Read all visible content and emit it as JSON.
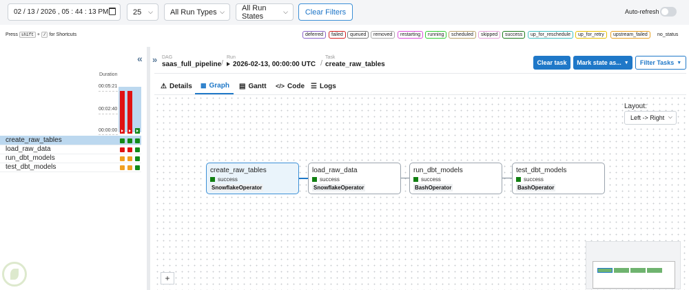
{
  "filters": {
    "datetime": "02 / 13 / 2026 ,  05 : 44 : 13  PM",
    "page_size": "25",
    "run_types": "All Run Types",
    "run_states": "All Run States",
    "clear_filters": "Clear Filters",
    "auto_refresh": "Auto-refresh",
    "auto_refresh_on": false
  },
  "shortcuts": {
    "press": "Press",
    "key1": "shift",
    "plus": "+",
    "key2": "/",
    "suffix": "for Shortcuts"
  },
  "states": [
    {
      "label": "deferred",
      "color": "#8a64c8"
    },
    {
      "label": "failed",
      "color": "#d21f1f"
    },
    {
      "label": "queued",
      "color": "#777777"
    },
    {
      "label": "removed",
      "color": "#aaaaaa"
    },
    {
      "label": "restarting",
      "color": "#d94fd9"
    },
    {
      "label": "running",
      "color": "#32cd32"
    },
    {
      "label": "scheduled",
      "color": "#b8a16a"
    },
    {
      "label": "skipped",
      "color": "#e4a0d8"
    },
    {
      "label": "success",
      "color": "#1b7a1b"
    },
    {
      "label": "up_for_reschedule",
      "color": "#40c0c0"
    },
    {
      "label": "up_for_retry",
      "color": "#e8c000"
    },
    {
      "label": "upstream_failed",
      "color": "#e8a020"
    },
    {
      "label": "no_status",
      "color": "#ffffff"
    }
  ],
  "grid": {
    "duration_label": "Duration",
    "ticks": [
      "00:05:21",
      "00:02:40",
      "00:00:00"
    ],
    "runs": [
      {
        "fraction": 0.97,
        "color": "#e01212"
      },
      {
        "fraction": 0.97,
        "color": "#e01212"
      },
      {
        "fraction": 0.12,
        "color": "#16881b"
      }
    ],
    "tasks": [
      {
        "name": "create_raw_tables",
        "states": [
          "#138a18",
          "#138a18",
          "#138a18"
        ]
      },
      {
        "name": "load_raw_data",
        "states": [
          "#e01212",
          "#e01212",
          "#138a18"
        ]
      },
      {
        "name": "run_dbt_models",
        "states": [
          "#f0a020",
          "#f0a020",
          "#138a18"
        ]
      },
      {
        "name": "test_dbt_models",
        "states": [
          "#f0a020",
          "#f0a020",
          "#138a18"
        ]
      }
    ]
  },
  "breadcrumb": {
    "dag_label": "DAG",
    "dag": "saas_full_pipeline",
    "run_label": "Run",
    "run": "2026-02-13, 00:00:00 UTC",
    "task_label": "Task",
    "task": "create_raw_tables"
  },
  "actions": {
    "clear_task": "Clear task",
    "mark_state": "Mark state as...",
    "filter_tasks": "Filter Tasks"
  },
  "tabs": [
    "Details",
    "Graph",
    "Gantt",
    "Code",
    "Logs"
  ],
  "graph": {
    "layout_label": "Layout:",
    "layout_value": "Left -> Right",
    "nodes": [
      {
        "name": "create_raw_tables",
        "state": "success",
        "operator": "SnowflakeOperator"
      },
      {
        "name": "load_raw_data",
        "state": "success",
        "operator": "SnowflakeOperator"
      },
      {
        "name": "run_dbt_models",
        "state": "success",
        "operator": "BashOperator"
      },
      {
        "name": "test_dbt_models",
        "state": "success",
        "operator": "BashOperator"
      }
    ],
    "zoom_in": "+"
  }
}
